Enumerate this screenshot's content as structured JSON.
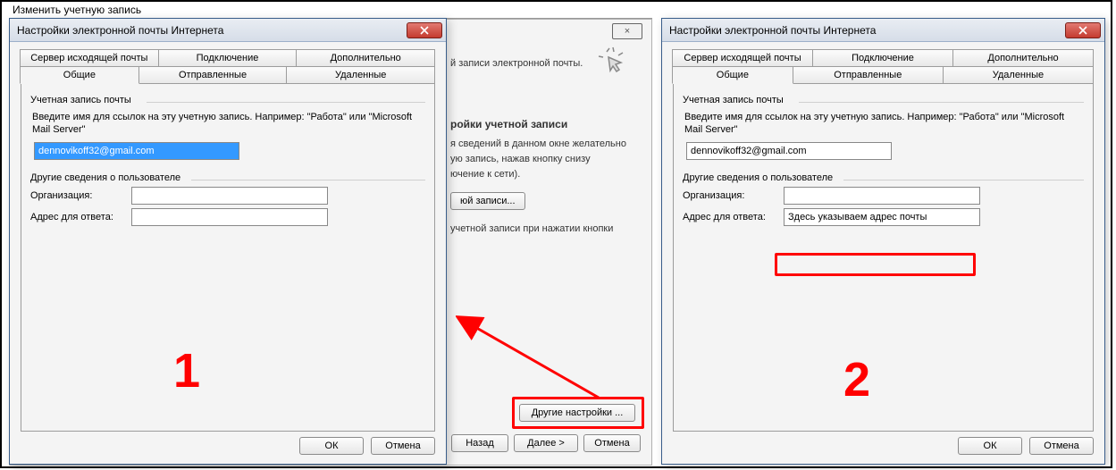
{
  "parent": {
    "title": "Изменить учетную запись",
    "bg_line1": "й записи электронной почты.",
    "bg_heading": "ройки учетной записи",
    "bg_text1": "я сведений в данном окне желательно",
    "bg_text2": "ую запись, нажав кнопку снизу",
    "bg_text3": "ючение к сети).",
    "btn_account": "юй записи...",
    "bg_text4": "учетной записи при нажатии кнопки",
    "btn_more": "Другие настройки ...",
    "btn_back": "Назад",
    "btn_next": "Далее >",
    "btn_cancel": "Отмена"
  },
  "dialog": {
    "title": "Настройки электронной почты Интернета",
    "tabs_top": {
      "outgoing": "Сервер исходящей почты",
      "connection": "Подключение",
      "advanced": "Дополнительно"
    },
    "tabs_bottom": {
      "general": "Общие",
      "sent": "Отправленные",
      "deleted": "Удаленные"
    },
    "group1": "Учетная запись почты",
    "instruction": "Введите имя для ссылок на эту учетную запись. Например: \"Работа\" или \"Microsoft Mail Server\"",
    "account_value": "dennovikoff32@gmail.com",
    "group2": "Другие сведения о пользователе",
    "label_org": "Организация:",
    "label_reply": "Адрес для ответа:",
    "reply_value2": "Здесь указываем адрес почты",
    "btn_ok": "ОК",
    "btn_cancel": "Отмена"
  },
  "annotations": {
    "n1": "1",
    "n2": "2"
  }
}
